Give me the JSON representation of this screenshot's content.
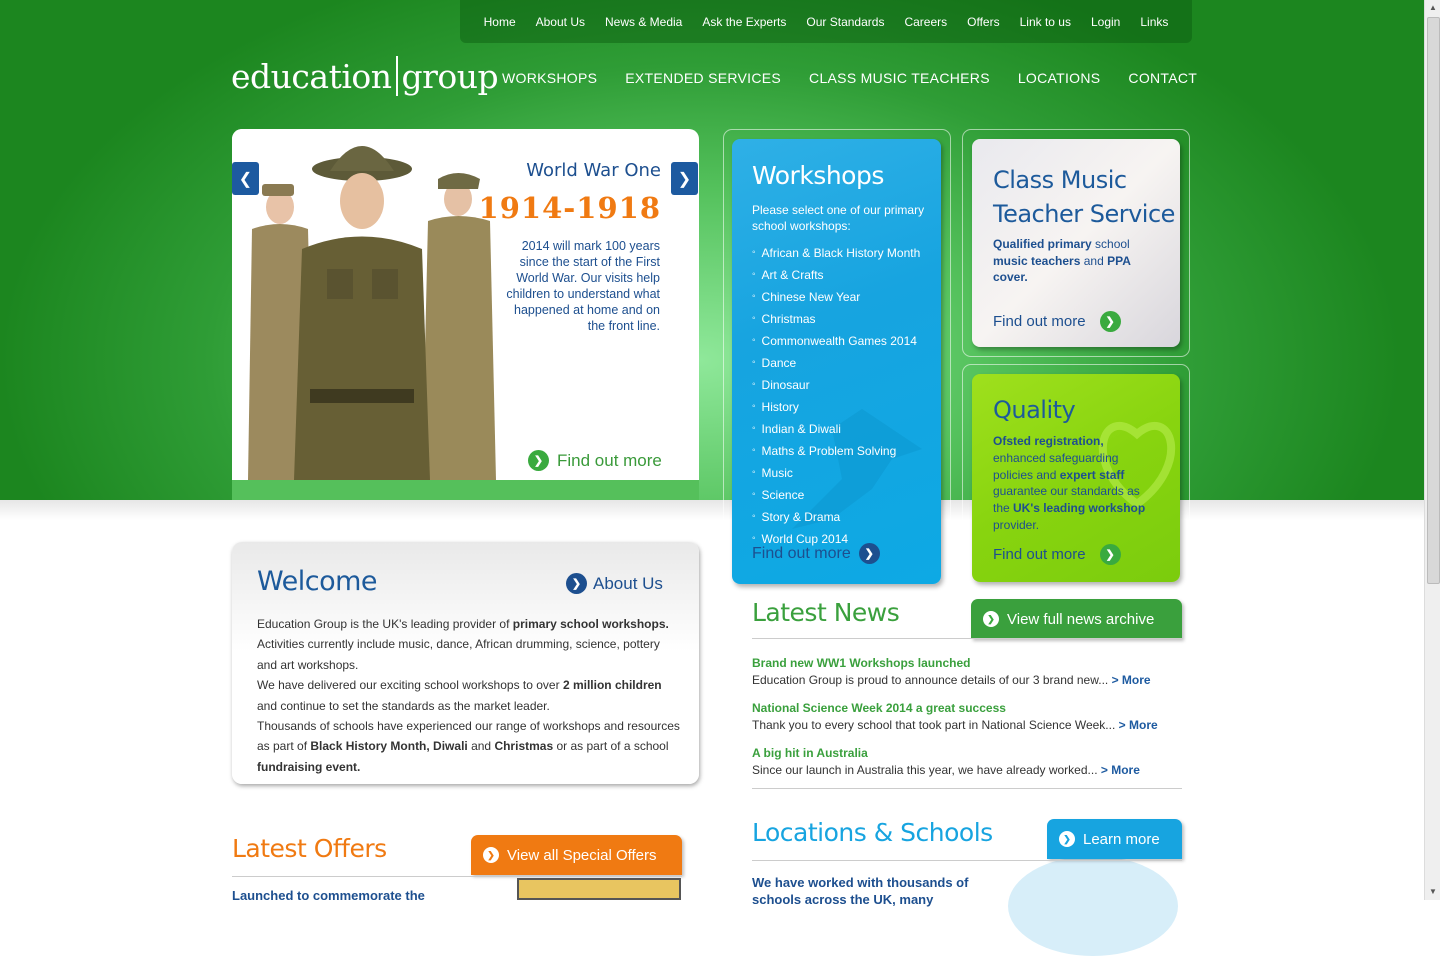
{
  "topnav": [
    "Home",
    "About Us",
    "News & Media",
    "Ask the Experts",
    "Our Standards",
    "Careers",
    "Offers",
    "Link to us",
    "Login",
    "Links"
  ],
  "logo": {
    "left": "education",
    "right": "group"
  },
  "mainnav": [
    "WORKSHOPS",
    "EXTENDED SERVICES",
    "CLASS MUSIC TEACHERS",
    "LOCATIONS",
    "CONTACT"
  ],
  "hero": {
    "title": "World War One",
    "years": "1914-1918",
    "text": "2014 will mark 100 years since the start of the First World War. Our visits help children to understand what happened at home and on the front line.",
    "more": "Find out more"
  },
  "workshops": {
    "title": "Workshops",
    "intro": "Please select one of our primary school workshops:",
    "items": [
      "African & Black History Month",
      "Art & Crafts",
      "Chinese New Year",
      "Christmas",
      "Commonwealth Games 2014",
      "Dance",
      "Dinosaur",
      "History",
      "Indian & Diwali",
      "Maths & Problem Solving",
      "Music",
      "Science",
      "Story & Drama",
      "World Cup 2014"
    ],
    "more": "Find out more"
  },
  "music": {
    "title_line1": "Class Music",
    "title_line2": "Teacher Service",
    "desc_b1": "Qualified primary",
    "desc_n1": " school ",
    "desc_b2": "music teachers",
    "desc_n2": " and ",
    "desc_b3": "PPA cover.",
    "more": "Find out more"
  },
  "quality": {
    "title": "Quality",
    "d_b1": "Ofsted registration,",
    "d_n1": " enhanced safeguarding policies and ",
    "d_b2": "expert staff",
    "d_n2": " guarantee our standards as the ",
    "d_b3": "UK's leading workshop",
    "d_n3": " provider.",
    "more": "Find out more"
  },
  "welcome": {
    "title": "Welcome",
    "about": "About Us",
    "p1a": "Education Group is the UK's leading provider of ",
    "p1b": "primary school workshops.",
    "p2": "Activities currently include music, dance, African drumming, science, pottery and art workshops.",
    "p3a": "We have delivered our exciting school workshops to over ",
    "p3b": "2 million children",
    "p3c": " and continue to set the standards as the market leader.",
    "p4a": "Thousands of schools have experienced our range of workshops and resources as part of ",
    "p4b": "Black History Month, Diwali",
    "p4c": " and ",
    "p4d": "Christmas",
    "p4e": " or as part of a school ",
    "p4f": "fundraising event."
  },
  "news": {
    "title": "Latest News",
    "archive": "View full news archive",
    "items": [
      {
        "headline": "Brand new WW1 Workshops launched",
        "text": "Education Group is proud to announce details of our 3 brand new...",
        "more": "> More"
      },
      {
        "headline": "National Science Week 2014 a great success",
        "text": "Thank you to every school that took part in National Science Week...",
        "more": "> More"
      },
      {
        "headline": "A big hit in Australia",
        "text": "Since our launch in Australia this year, we have already worked...",
        "more": "> More"
      }
    ]
  },
  "offers": {
    "title": "Latest Offers",
    "button": "View all Special Offers",
    "text": "Launched to commemorate the"
  },
  "locations": {
    "title": "Locations & Schools",
    "button": "Learn more",
    "text": "We have worked with thousands of schools across the UK, many"
  },
  "colors": {
    "green": "#3aa03d",
    "navy": "#1d4f8f",
    "orange": "#f07a12",
    "cyan": "#17a4e0",
    "lime": "#88d40f"
  }
}
